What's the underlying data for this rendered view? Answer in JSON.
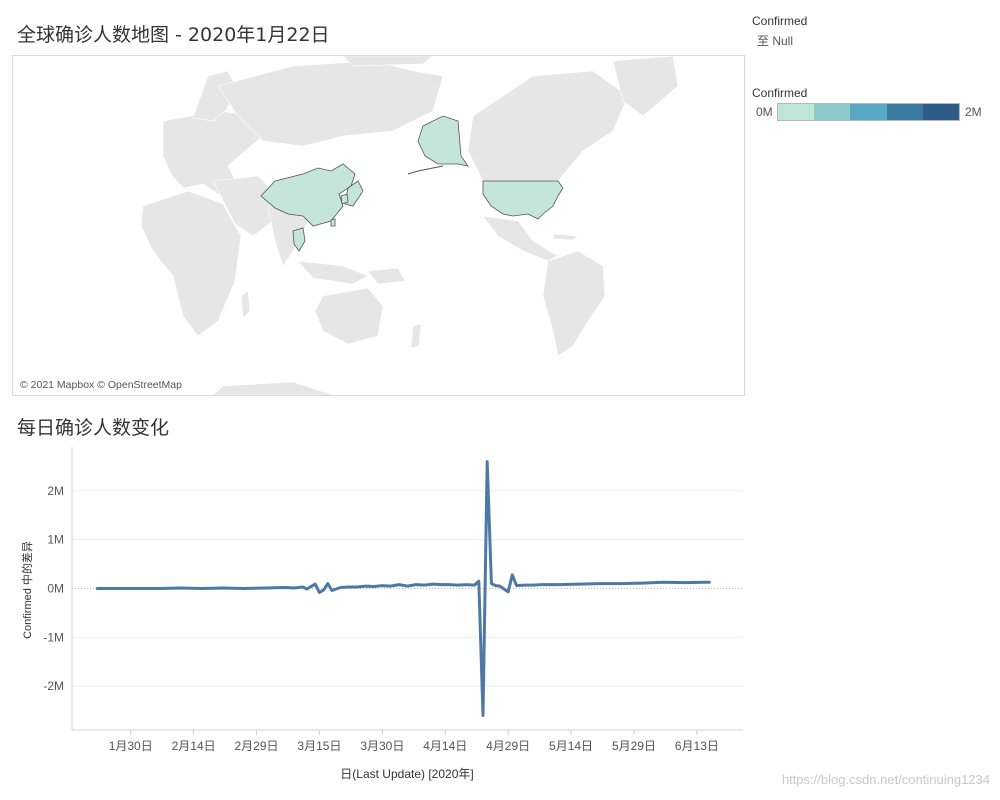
{
  "map": {
    "title": "全球确诊人数地图 - 2020年1月22日",
    "attribution": "© 2021 Mapbox © OpenStreetMap",
    "land_color": "#e6e6e6",
    "highlight_color": "#c5e5da",
    "highlight_stroke": "#555555",
    "highlighted_regions": [
      "china",
      "japan",
      "thailand",
      "south-korea",
      "taiwan",
      "alaska",
      "united-states"
    ]
  },
  "legend": {
    "null_block": {
      "title": "Confirmed",
      "null_text": "至 Null"
    },
    "color_block": {
      "title": "Confirmed",
      "min_label": "0M",
      "max_label": "2M",
      "colors": [
        "#bfe4d8",
        "#8ccacc",
        "#56a9c1",
        "#3b7ba3",
        "#2e5b87"
      ]
    }
  },
  "chart": {
    "title": "每日确诊人数变化",
    "line_color": "#4e79a7"
  },
  "chart_data": {
    "type": "line",
    "xlabel": "日(Last Update) [2020年]",
    "ylabel": "Confirmed 中的差异",
    "ylim": [
      -2.9,
      2.9
    ],
    "y_ticks": [
      2,
      1,
      0,
      -1,
      -2
    ],
    "y_tick_labels": [
      "2M",
      "1M",
      "0M",
      "-1M",
      "-2M"
    ],
    "x_tick_labels": [
      "1月30日",
      "2月14日",
      "2月29日",
      "3月15日",
      "3月30日",
      "4月14日",
      "4月29日",
      "5月14日",
      "5月29日",
      "6月13日"
    ],
    "x_tick_day_index": [
      8,
      23,
      38,
      53,
      68,
      83,
      98,
      113,
      128,
      143
    ],
    "series": [
      {
        "x": [
          0,
          5,
          10,
          15,
          20,
          25,
          30,
          35,
          40,
          45,
          47,
          49,
          50,
          52,
          53,
          54,
          55,
          56,
          58,
          60,
          62,
          64,
          66,
          68,
          70,
          72,
          74,
          76,
          78,
          80,
          82,
          84,
          86,
          88,
          90,
          91,
          92,
          93,
          94,
          95,
          96,
          98,
          99,
          100,
          102,
          104,
          106,
          110,
          115,
          120,
          125,
          130,
          135,
          140,
          145,
          146
        ],
        "y": [
          0,
          0,
          0,
          0,
          0.01,
          0,
          0.01,
          0,
          0.01,
          0.02,
          0.01,
          0.03,
          -0.01,
          0.09,
          -0.08,
          -0.03,
          0.1,
          -0.04,
          0.02,
          0.03,
          0.03,
          0.05,
          0.04,
          0.06,
          0.05,
          0.08,
          0.05,
          0.08,
          0.07,
          0.09,
          0.08,
          0.08,
          0.07,
          0.08,
          0.07,
          0.15,
          -2.6,
          2.6,
          0.1,
          0.06,
          0.05,
          -0.07,
          0.28,
          0.06,
          0.07,
          0.07,
          0.08,
          0.08,
          0.09,
          0.1,
          0.1,
          0.11,
          0.13,
          0.12,
          0.13,
          0.13
        ]
      }
    ]
  }
}
